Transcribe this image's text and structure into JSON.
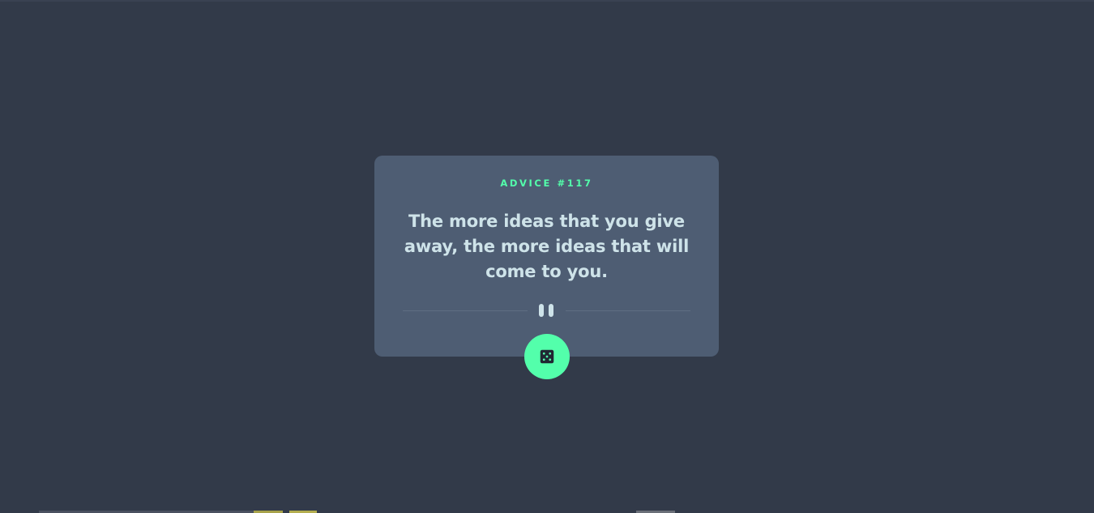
{
  "card": {
    "advice_id": "ADVICE #117",
    "advice_text": "The more ideas that you give away, the more ideas that will come to you."
  },
  "icons": {
    "divider": "pause-icon",
    "button": "dice-icon"
  },
  "colors": {
    "background": "#323a49",
    "card": "#4e5d73",
    "accent": "#53ffab",
    "text": "#cee3e9"
  }
}
